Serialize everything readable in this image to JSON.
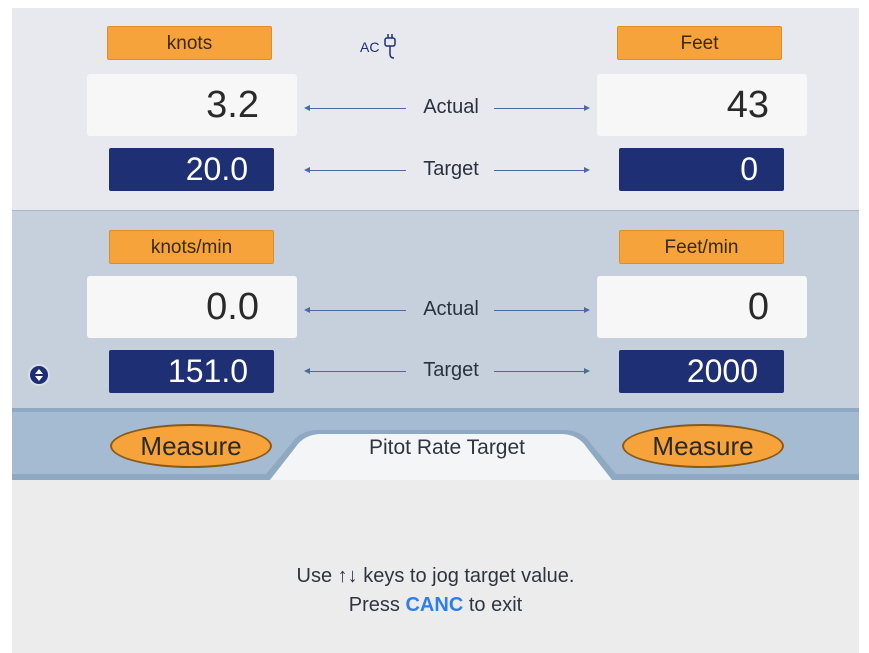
{
  "header": {
    "ac_label": "AC"
  },
  "speed": {
    "unit": "knots",
    "actual": "3.2",
    "target": "20.0"
  },
  "altitude": {
    "unit": "Feet",
    "actual": "43",
    "target": "0"
  },
  "speed_rate": {
    "unit": "knots/min",
    "actual": "0.0",
    "target": "151.0"
  },
  "altitude_rate": {
    "unit": "Feet/min",
    "actual": "0",
    "target": "2000"
  },
  "labels": {
    "actual": "Actual",
    "target": "Target"
  },
  "tabs": {
    "left_measure": "Measure",
    "center_title": "Pitot Rate Target",
    "right_measure": "Measure"
  },
  "help": {
    "line1": "Use ↑↓ keys to jog target value.",
    "line2_prefix": "Press",
    "line2_key": "CANC",
    "line2_suffix": "to exit"
  },
  "colors": {
    "unit_label_bg": "#f5a33a",
    "target_bg": "#1e2f73",
    "rate_section_bg": "#c5d0dc",
    "accent_blue": "#2f7fe8"
  },
  "icons": {
    "ac_plug": "plug-icon",
    "side": "up-down-icon"
  }
}
